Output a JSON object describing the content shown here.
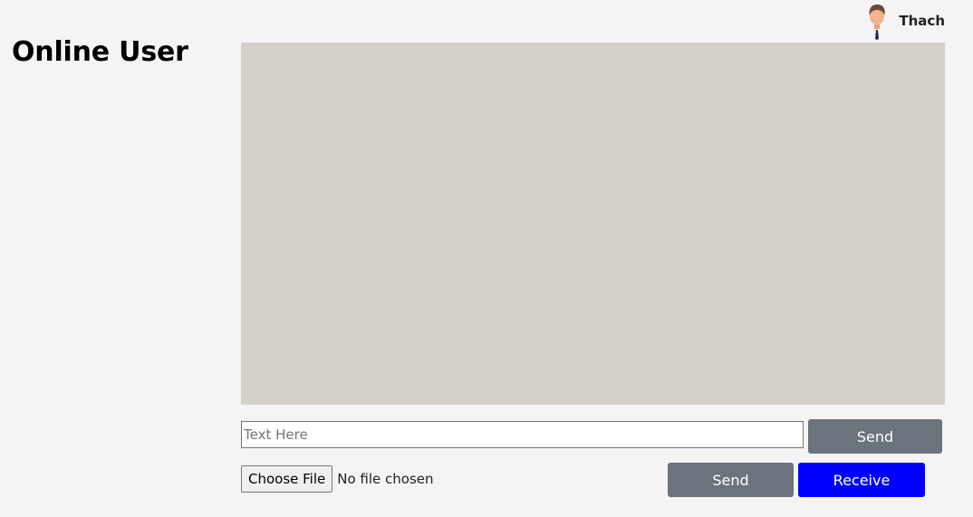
{
  "header": {
    "username": "Thach",
    "avatar_icon": "user-avatar-icon"
  },
  "sidebar": {
    "title": "Online User"
  },
  "chat": {
    "message_placeholder": "Text Here",
    "message_value": "",
    "send_label": "Send"
  },
  "file": {
    "choose_label": "Choose File",
    "status": "No file chosen",
    "send_label": "Send",
    "receive_label": "Receive"
  },
  "colors": {
    "background": "#f4f4f4",
    "chat_area": "#d4d1cb",
    "button_gray": "#6c737d",
    "button_blue": "#0000ff"
  }
}
